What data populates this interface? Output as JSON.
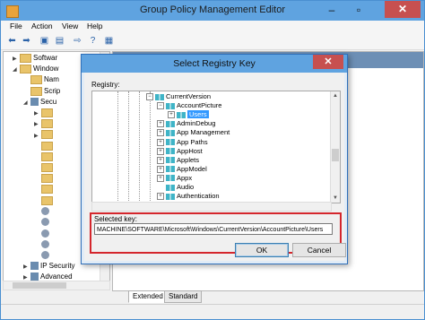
{
  "window": {
    "title": "Group Policy Management Editor"
  },
  "menu": [
    "File",
    "Action",
    "View",
    "Help"
  ],
  "left_tree": [
    {
      "label": "Softwar",
      "expander": "▶",
      "icon": "folder"
    },
    {
      "label": "Window",
      "expander": "◢",
      "icon": "folder"
    },
    {
      "label": "Nam",
      "expander": "",
      "icon": "folder"
    },
    {
      "label": "Scrip",
      "expander": "",
      "icon": "folder"
    },
    {
      "label": "Secu",
      "expander": "◢",
      "icon": "shield"
    },
    {
      "label": "",
      "expander": "▶",
      "icon": "folder"
    },
    {
      "label": "",
      "expander": "▶",
      "icon": "folder"
    },
    {
      "label": "",
      "expander": "▶",
      "icon": "folder"
    },
    {
      "label": "",
      "expander": "",
      "icon": "folder"
    },
    {
      "label": "",
      "expander": "",
      "icon": "folder"
    },
    {
      "label": "",
      "expander": "",
      "icon": "folder"
    },
    {
      "label": "",
      "expander": "",
      "icon": "folder"
    },
    {
      "label": "",
      "expander": "",
      "icon": "folder"
    },
    {
      "label": "",
      "expander": "",
      "icon": "folder"
    },
    {
      "label": "",
      "expander": "",
      "icon": "gear"
    },
    {
      "label": "",
      "expander": "",
      "icon": "gear"
    },
    {
      "label": "",
      "expander": "",
      "icon": "gear"
    },
    {
      "label": "",
      "expander": "",
      "icon": "gear"
    },
    {
      "label": "",
      "expander": "",
      "icon": "gear"
    },
    {
      "label": "IP Security",
      "expander": "▶",
      "icon": "shield"
    },
    {
      "label": "Advanced",
      "expander": "▶",
      "icon": "shield"
    }
  ],
  "tabs": [
    "Extended",
    "Standard"
  ],
  "dialog": {
    "title": "Select Registry Key",
    "registry_label": "Registry:",
    "tree": [
      {
        "label": "CurrentVersion",
        "level": 0,
        "expander": "−",
        "selected": false
      },
      {
        "label": "AccountPicture",
        "level": 1,
        "expander": "−",
        "selected": false
      },
      {
        "label": "Users",
        "level": 2,
        "expander": "+",
        "selected": true
      },
      {
        "label": "AdminDebug",
        "level": 1,
        "expander": "+",
        "selected": false
      },
      {
        "label": "App Management",
        "level": 1,
        "expander": "+",
        "selected": false
      },
      {
        "label": "App Paths",
        "level": 1,
        "expander": "+",
        "selected": false
      },
      {
        "label": "AppHost",
        "level": 1,
        "expander": "+",
        "selected": false
      },
      {
        "label": "Applets",
        "level": 1,
        "expander": "+",
        "selected": false
      },
      {
        "label": "AppModel",
        "level": 1,
        "expander": "+",
        "selected": false
      },
      {
        "label": "Appx",
        "level": 1,
        "expander": "+",
        "selected": false
      },
      {
        "label": "Audio",
        "level": 1,
        "expander": "",
        "selected": false
      },
      {
        "label": "Authentication",
        "level": 1,
        "expander": "+",
        "selected": false
      }
    ],
    "selected_key_label": "Selected key:",
    "selected_key_value": "MACHINE\\SOFTWARE\\Microsoft\\Windows\\CurrentVersion\\AccountPicture\\Users",
    "ok_label": "OK",
    "cancel_label": "Cancel"
  },
  "colors": {
    "titlebar": "#5fa3e0",
    "close": "#c75050",
    "highlight": "#d4262c",
    "selection": "#3399ff"
  }
}
